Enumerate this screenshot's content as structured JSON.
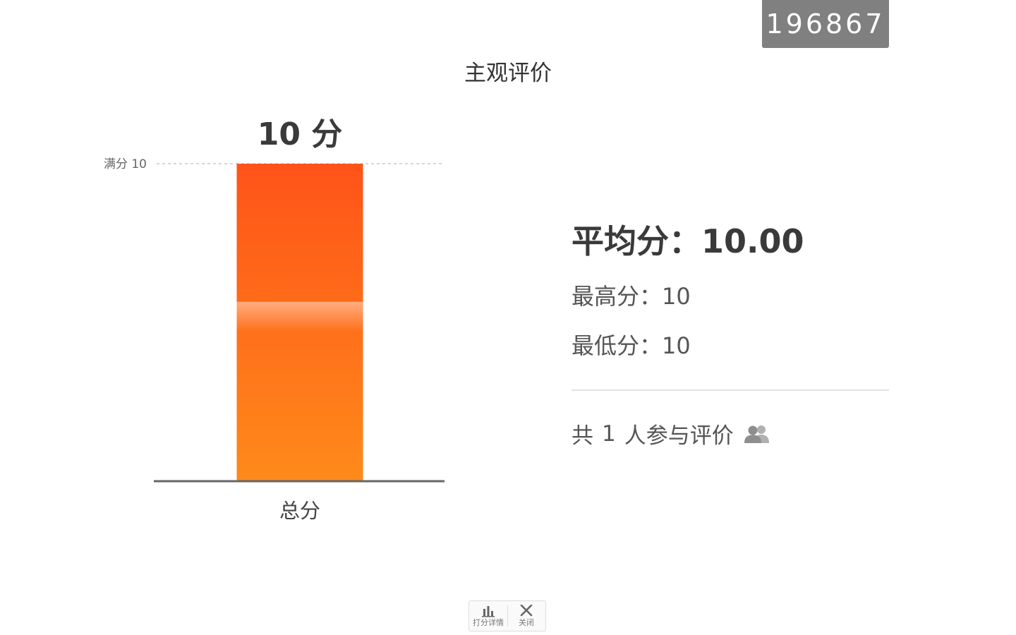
{
  "room_id": "196867",
  "page_title": "主观评价",
  "chart_data": {
    "type": "bar",
    "categories": [
      "总分"
    ],
    "values": [
      10
    ],
    "value_labels": [
      "10 分"
    ],
    "ylim": [
      0,
      10
    ],
    "reference_line": {
      "label": "满分 10",
      "value": 10
    },
    "colors": {
      "top": "#ff5319",
      "bottom": "#ff8a1a"
    }
  },
  "summary": {
    "avg_label": "平均分",
    "avg_value": "10.00",
    "max_label": "最高分",
    "max_value": "10",
    "min_label": "最低分",
    "min_value": "10",
    "participants_prefix": "共",
    "participants_count": "1",
    "participants_suffix": "人参与评价",
    "icon": "people-icon"
  },
  "toolbar": {
    "details_label": "打分详情",
    "details_icon": "bar-chart-icon",
    "close_label": "关闭",
    "close_icon": "close-icon"
  }
}
